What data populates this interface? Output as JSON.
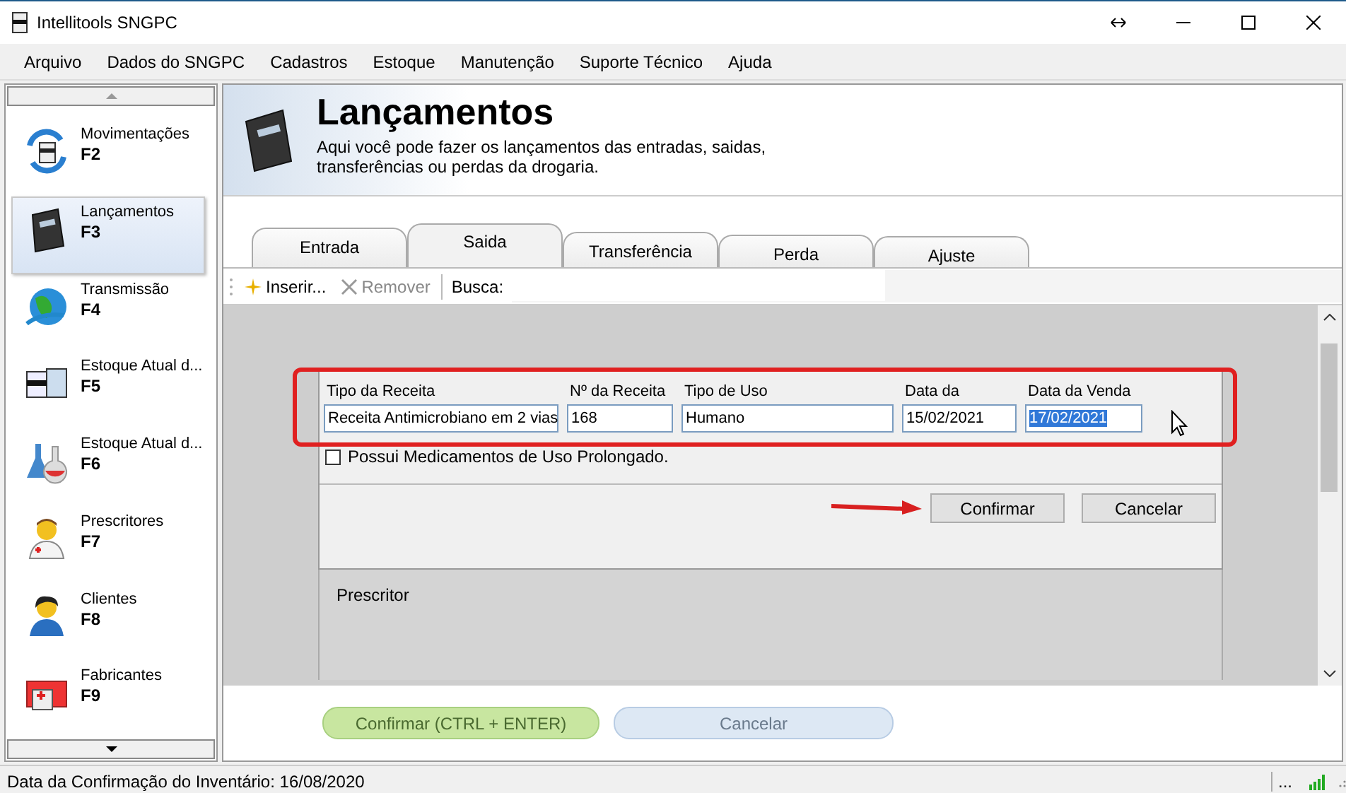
{
  "window": {
    "title": "Intellitools SNGPC"
  },
  "menu": [
    "Arquivo",
    "Dados do SNGPC",
    "Cadastros",
    "Estoque",
    "Manutenção",
    "Suporte Técnico",
    "Ajuda"
  ],
  "sidebar": {
    "items": [
      {
        "label": "Movimentações",
        "key": "F2",
        "selected": false
      },
      {
        "label": "Lançamentos",
        "key": "F3",
        "selected": true
      },
      {
        "label": "Transmissão",
        "key": "F4",
        "selected": false
      },
      {
        "label": "Estoque Atual d...",
        "key": "F5",
        "selected": false
      },
      {
        "label": "Estoque Atual d...",
        "key": "F6",
        "selected": false
      },
      {
        "label": "Prescritores",
        "key": "F7",
        "selected": false
      },
      {
        "label": "Clientes",
        "key": "F8",
        "selected": false
      },
      {
        "label": "Fabricantes",
        "key": "F9",
        "selected": false
      }
    ]
  },
  "header": {
    "title": "Lançamentos",
    "description": "Aqui você pode fazer os lançamentos das entradas, saidas, transferências ou perdas da drogaria."
  },
  "tabs": [
    {
      "label": "Entrada",
      "selected": false
    },
    {
      "label": "Saida",
      "selected": true
    },
    {
      "label": "Transferência",
      "selected": false
    },
    {
      "label": "Perda",
      "selected": false
    },
    {
      "label": "Ajuste",
      "selected": false
    }
  ],
  "toolbar": {
    "insert": {
      "label": "Inserir...",
      "disabled": false
    },
    "remove": {
      "label": "Remover",
      "disabled": true
    },
    "search_label": "Busca:"
  },
  "form": {
    "fields": [
      {
        "label": "Tipo da Receita",
        "value": "Receita Antimicrobiano em 2 vias",
        "highlighted": false
      },
      {
        "label": "Nº da Receita",
        "value": "168",
        "highlighted": false
      },
      {
        "label": "Tipo de Uso",
        "value": "Humano",
        "highlighted": false
      },
      {
        "label": "Data da",
        "value": "15/02/2021",
        "highlighted": false
      },
      {
        "label": "Data da Venda",
        "value": "17/02/2021",
        "highlighted": true
      }
    ],
    "checkbox": {
      "label": "Possui Medicamentos de Uso Prolongado.",
      "checked": false
    },
    "buttons": [
      "Confirmar",
      "Cancelar"
    ],
    "section": "Prescritor"
  },
  "footer_buttons": [
    {
      "label": "Confirmar (CTRL + ENTER)",
      "kind": "primary"
    },
    {
      "label": "Cancelar",
      "kind": "secondary"
    }
  ],
  "status_bar": {
    "text": "Data da Confirmação do Inventário: 16/08/2020",
    "more": "..."
  }
}
